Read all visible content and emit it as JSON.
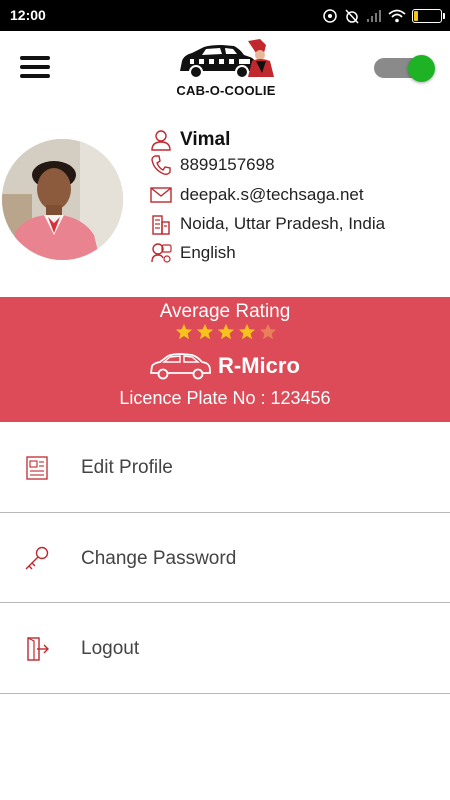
{
  "status_bar": {
    "time": "12:00",
    "battery_level": "14",
    "battery_fraction": 0.14
  },
  "app_bar": {
    "logo_text": "CAB-O-COOLIE",
    "toggle_on": true
  },
  "colors": {
    "accent_red": "#dc4b57",
    "icon_red": "#c0282e",
    "toggle_green": "#1db324",
    "star_gold": "#f7c21c",
    "star_empty": "#e9805a"
  },
  "profile": {
    "name": "Vimal",
    "phone": "8899157698",
    "email": "deepak.s@techsaga.net",
    "location": "Noida, Uttar Pradesh, India",
    "language": "English",
    "icons": [
      "person-icon",
      "phone-icon",
      "mail-icon",
      "building-icon",
      "language-icon"
    ]
  },
  "rating": {
    "label": "Average Rating",
    "value": 4,
    "max": 5
  },
  "vehicle": {
    "name": "R-Micro",
    "plate_text": "Licence Plate No : 123456"
  },
  "menu": {
    "items": [
      {
        "label": "Edit Profile",
        "icon": "edit-profile-icon"
      },
      {
        "label": "Change Password",
        "icon": "key-icon"
      },
      {
        "label": "Logout",
        "icon": "logout-icon"
      }
    ]
  }
}
